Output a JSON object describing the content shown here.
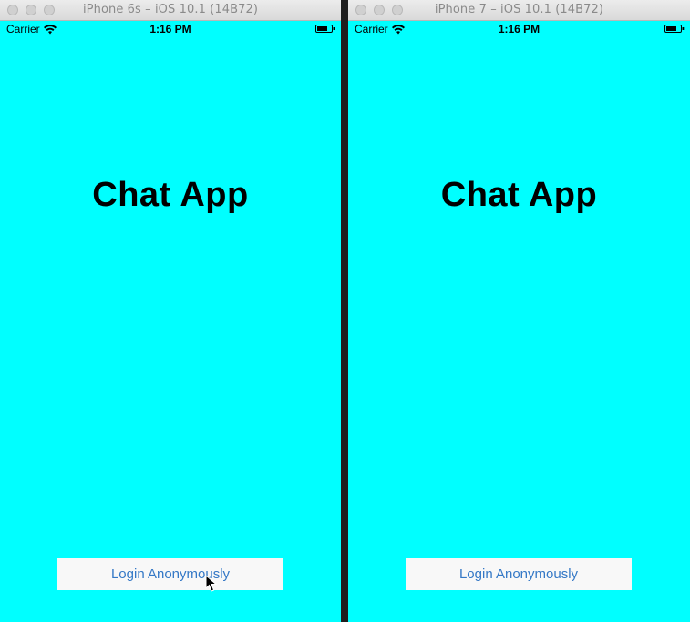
{
  "simulators": [
    {
      "window_title": "iPhone 6s – iOS 10.1 (14B72)",
      "status": {
        "carrier": "Carrier",
        "time": "1:16 PM"
      },
      "app_title": "Chat App",
      "login_button": "Login Anonymously"
    },
    {
      "window_title": "iPhone 7 – iOS 10.1 (14B72)",
      "status": {
        "carrier": "Carrier",
        "time": "1:16 PM"
      },
      "app_title": "Chat App",
      "login_button": "Login Anonymously"
    }
  ],
  "colors": {
    "screen_background": "#00ffff",
    "button_text": "#3478c6",
    "button_background": "#f8f8f8"
  },
  "icons": [
    "wifi-icon",
    "battery-icon",
    "mouse-cursor-icon"
  ]
}
